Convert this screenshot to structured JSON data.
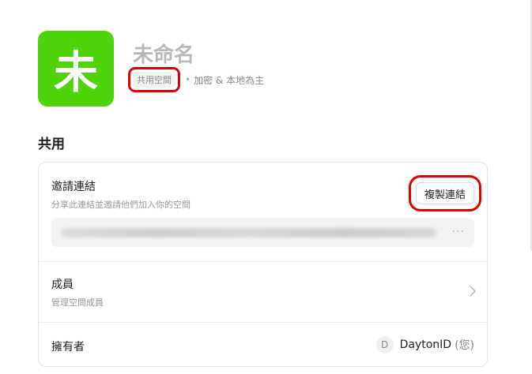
{
  "space": {
    "avatar_letter": "未",
    "avatar_color": "#4fd40a",
    "title": "未命名",
    "type_badge": "共用空間",
    "meta_separator": "•",
    "meta_description": "加密 & 本地為主"
  },
  "section": {
    "title": "共用"
  },
  "invite": {
    "title": "邀請連結",
    "subtitle": "分享此連結並邀請他們加入你的空間",
    "copy_button_label": "複製連結",
    "link_value": "████████████████████████████████",
    "more_icon": "···"
  },
  "members": {
    "title": "成員",
    "subtitle": "管理空間成員",
    "chevron_icon": "chevron-right-icon"
  },
  "owner": {
    "label": "擁有者",
    "avatar_letter": "D",
    "name": "DaytonID",
    "you_suffix": "(您)"
  },
  "colors": {
    "highlight": "#e00000",
    "accent_green": "#4fd40a"
  }
}
